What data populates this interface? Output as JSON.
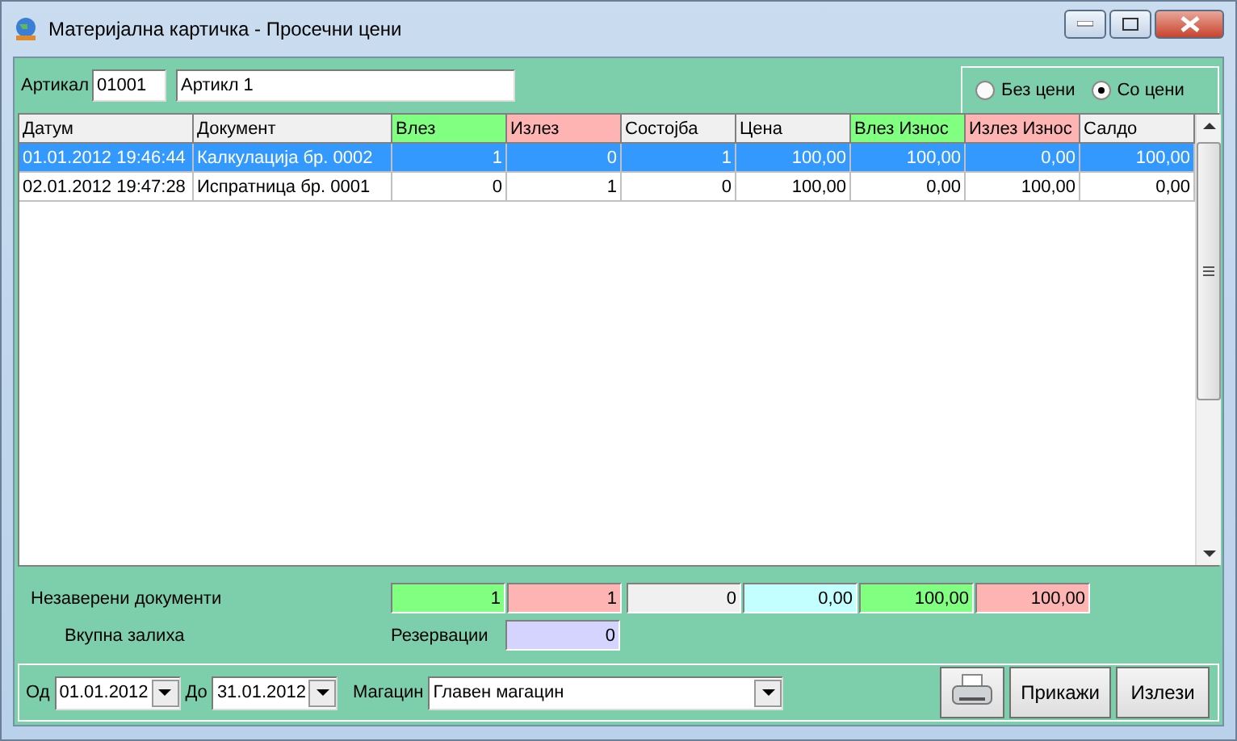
{
  "window": {
    "title": "Материјална картичка - Просечни цени"
  },
  "article": {
    "label": "Артикал",
    "code": "01001",
    "name": "Артикл 1"
  },
  "price_mode": [
    {
      "label": "Без цени",
      "selected": false
    },
    {
      "label": "Со цени",
      "selected": true
    }
  ],
  "table": {
    "columns": [
      {
        "label": "Датум",
        "color": "#f0f0f0",
        "kind": "text"
      },
      {
        "label": "Документ",
        "color": "#f0f0f0",
        "kind": "text"
      },
      {
        "label": "Влез",
        "color": "#80ff80",
        "kind": "number"
      },
      {
        "label": "Излез",
        "color": "#ffb4b4",
        "kind": "number"
      },
      {
        "label": "Состојба",
        "color": "#f0f0f0",
        "kind": "number"
      },
      {
        "label": "Цена",
        "color": "#f0f0f0",
        "kind": "number"
      },
      {
        "label": "Влез Износ",
        "color": "#80ff80",
        "kind": "number"
      },
      {
        "label": "Излез Износ",
        "color": "#ffb4b4",
        "kind": "number"
      },
      {
        "label": "Салдо",
        "color": "#f0f0f0",
        "kind": "number"
      }
    ],
    "rows": [
      {
        "selected": true,
        "cells": [
          "01.01.2012 19:46:44",
          "Калкулација бр. 0002",
          "1",
          "0",
          "1",
          "100,00",
          "100,00",
          "0,00",
          "100,00"
        ]
      },
      {
        "selected": false,
        "cells": [
          "02.01.2012 19:47:28",
          "Испратница бр. 0001",
          "0",
          "1",
          "0",
          "100,00",
          "0,00",
          "100,00",
          "0,00"
        ]
      }
    ]
  },
  "summary": {
    "unverified_label": "Незаверени документи",
    "unverified": [
      {
        "value": "1",
        "color": "#80ff80"
      },
      {
        "value": "1",
        "color": "#ffb4b4"
      },
      {
        "value": "0",
        "color": "#f0f0f0"
      },
      {
        "value": "0,00",
        "color": "#c4ffff"
      },
      {
        "value": "100,00",
        "color": "#80ff80"
      },
      {
        "value": "100,00",
        "color": "#ffb4b4"
      }
    ],
    "total_label": "Вкупна залиха",
    "reservations_label": "Резервации",
    "reservations": {
      "value": "0",
      "color": "#d4d4ff"
    }
  },
  "filter": {
    "from_label": "Од",
    "from": "01.01.2012",
    "to_label": "До",
    "to": "31.01.2012",
    "warehouse_label": "Магацин",
    "warehouse": "Главен магацин"
  },
  "buttons": [
    "Прикажи",
    "Излези"
  ]
}
